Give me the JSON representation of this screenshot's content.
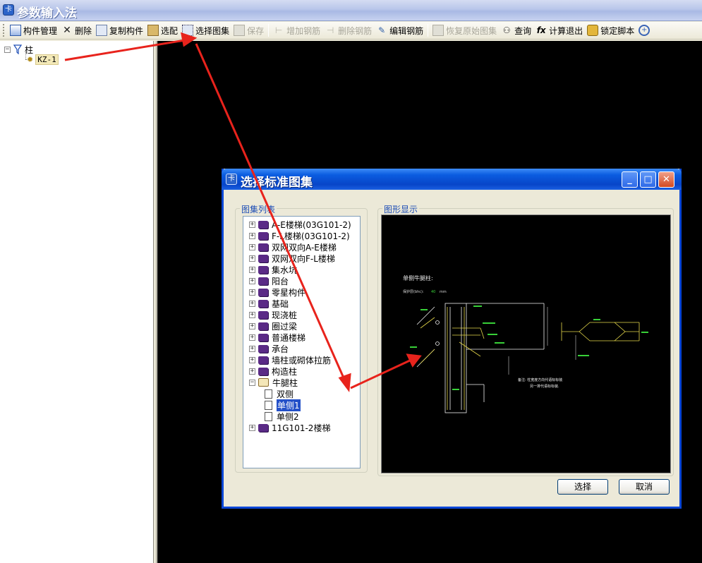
{
  "window": {
    "title": "参数输入法"
  },
  "toolbar": {
    "items": [
      {
        "label": "构件管理",
        "icon": "component-manager-icon",
        "enabled": true
      },
      {
        "label": "删除",
        "icon": "delete-icon",
        "enabled": true
      },
      {
        "label": "复制构件",
        "icon": "copy-icon",
        "enabled": true
      },
      {
        "label": "选配",
        "icon": "match-icon",
        "enabled": true
      },
      {
        "label": "选择图集",
        "icon": "select-atlas-icon",
        "enabled": true
      },
      {
        "label": "保存",
        "icon": "save-icon",
        "enabled": false
      },
      {
        "label": "增加钢筋",
        "icon": "add-rebar-icon",
        "enabled": false
      },
      {
        "label": "删除钢筋",
        "icon": "delete-rebar-icon",
        "enabled": false
      },
      {
        "label": "编辑钢筋",
        "icon": "edit-rebar-icon",
        "enabled": true
      },
      {
        "label": "恢复原始图集",
        "icon": "restore-atlas-icon",
        "enabled": false
      },
      {
        "label": "查询",
        "icon": "binoculars-icon",
        "enabled": true
      },
      {
        "label": "计算退出",
        "icon": "fx-icon",
        "enabled": true
      },
      {
        "label": "锁定脚本",
        "icon": "lock-icon",
        "enabled": true
      }
    ]
  },
  "tree": {
    "root": {
      "label": "柱",
      "expander": "⊟"
    },
    "child": {
      "label": "KZ-1"
    }
  },
  "dialog": {
    "title": "选择标准图集",
    "list_group_label": "图集列表",
    "view_group_label": "图形显示",
    "items": [
      {
        "label": "A-E楼梯(03G101-2)",
        "type": "book",
        "expander": "+"
      },
      {
        "label": "F-L楼梯(03G101-2)",
        "type": "book",
        "expander": "+"
      },
      {
        "label": "双网双向A-E楼梯",
        "type": "book",
        "expander": "+"
      },
      {
        "label": "双网双向F-L楼梯",
        "type": "book",
        "expander": "+"
      },
      {
        "label": "集水坑",
        "type": "book",
        "expander": "+"
      },
      {
        "label": "阳台",
        "type": "book",
        "expander": "+"
      },
      {
        "label": "零星构件",
        "type": "book",
        "expander": "+"
      },
      {
        "label": "基础",
        "type": "book",
        "expander": "+"
      },
      {
        "label": "现浇桩",
        "type": "book",
        "expander": "+"
      },
      {
        "label": "圈过梁",
        "type": "book",
        "expander": "+"
      },
      {
        "label": "普通楼梯",
        "type": "book",
        "expander": "+"
      },
      {
        "label": "承台",
        "type": "book",
        "expander": "+"
      },
      {
        "label": "墙柱或砌体拉筋",
        "type": "book",
        "expander": "+"
      },
      {
        "label": "构造柱",
        "type": "book",
        "expander": "+"
      },
      {
        "label": "牛腿柱",
        "type": "open-book",
        "expander": "−"
      },
      {
        "label": "双侧",
        "type": "doc",
        "expander": ""
      },
      {
        "label": "单侧1",
        "type": "doc",
        "expander": "",
        "selected": true
      },
      {
        "label": "单侧2",
        "type": "doc",
        "expander": ""
      },
      {
        "label": "11G101-2楼梯",
        "type": "book",
        "expander": "+"
      }
    ],
    "preview": {
      "heading": "单侧牛腿柱:",
      "cover_label": "保护层(bhc):",
      "cover_value": "40",
      "cover_unit": "mm",
      "note_line1": "备注: 柱宽度方向代语标标装",
      "note_line2": "另一排代语标标装."
    },
    "buttons": {
      "select": "选择",
      "cancel": "取消"
    }
  },
  "colors": {
    "annotation_arrow": "#e8231c",
    "drawing_line": "#f0f0f0",
    "drawing_yellow": "#e6d84a",
    "drawing_green": "#38d038",
    "selection": "#2350c8"
  }
}
